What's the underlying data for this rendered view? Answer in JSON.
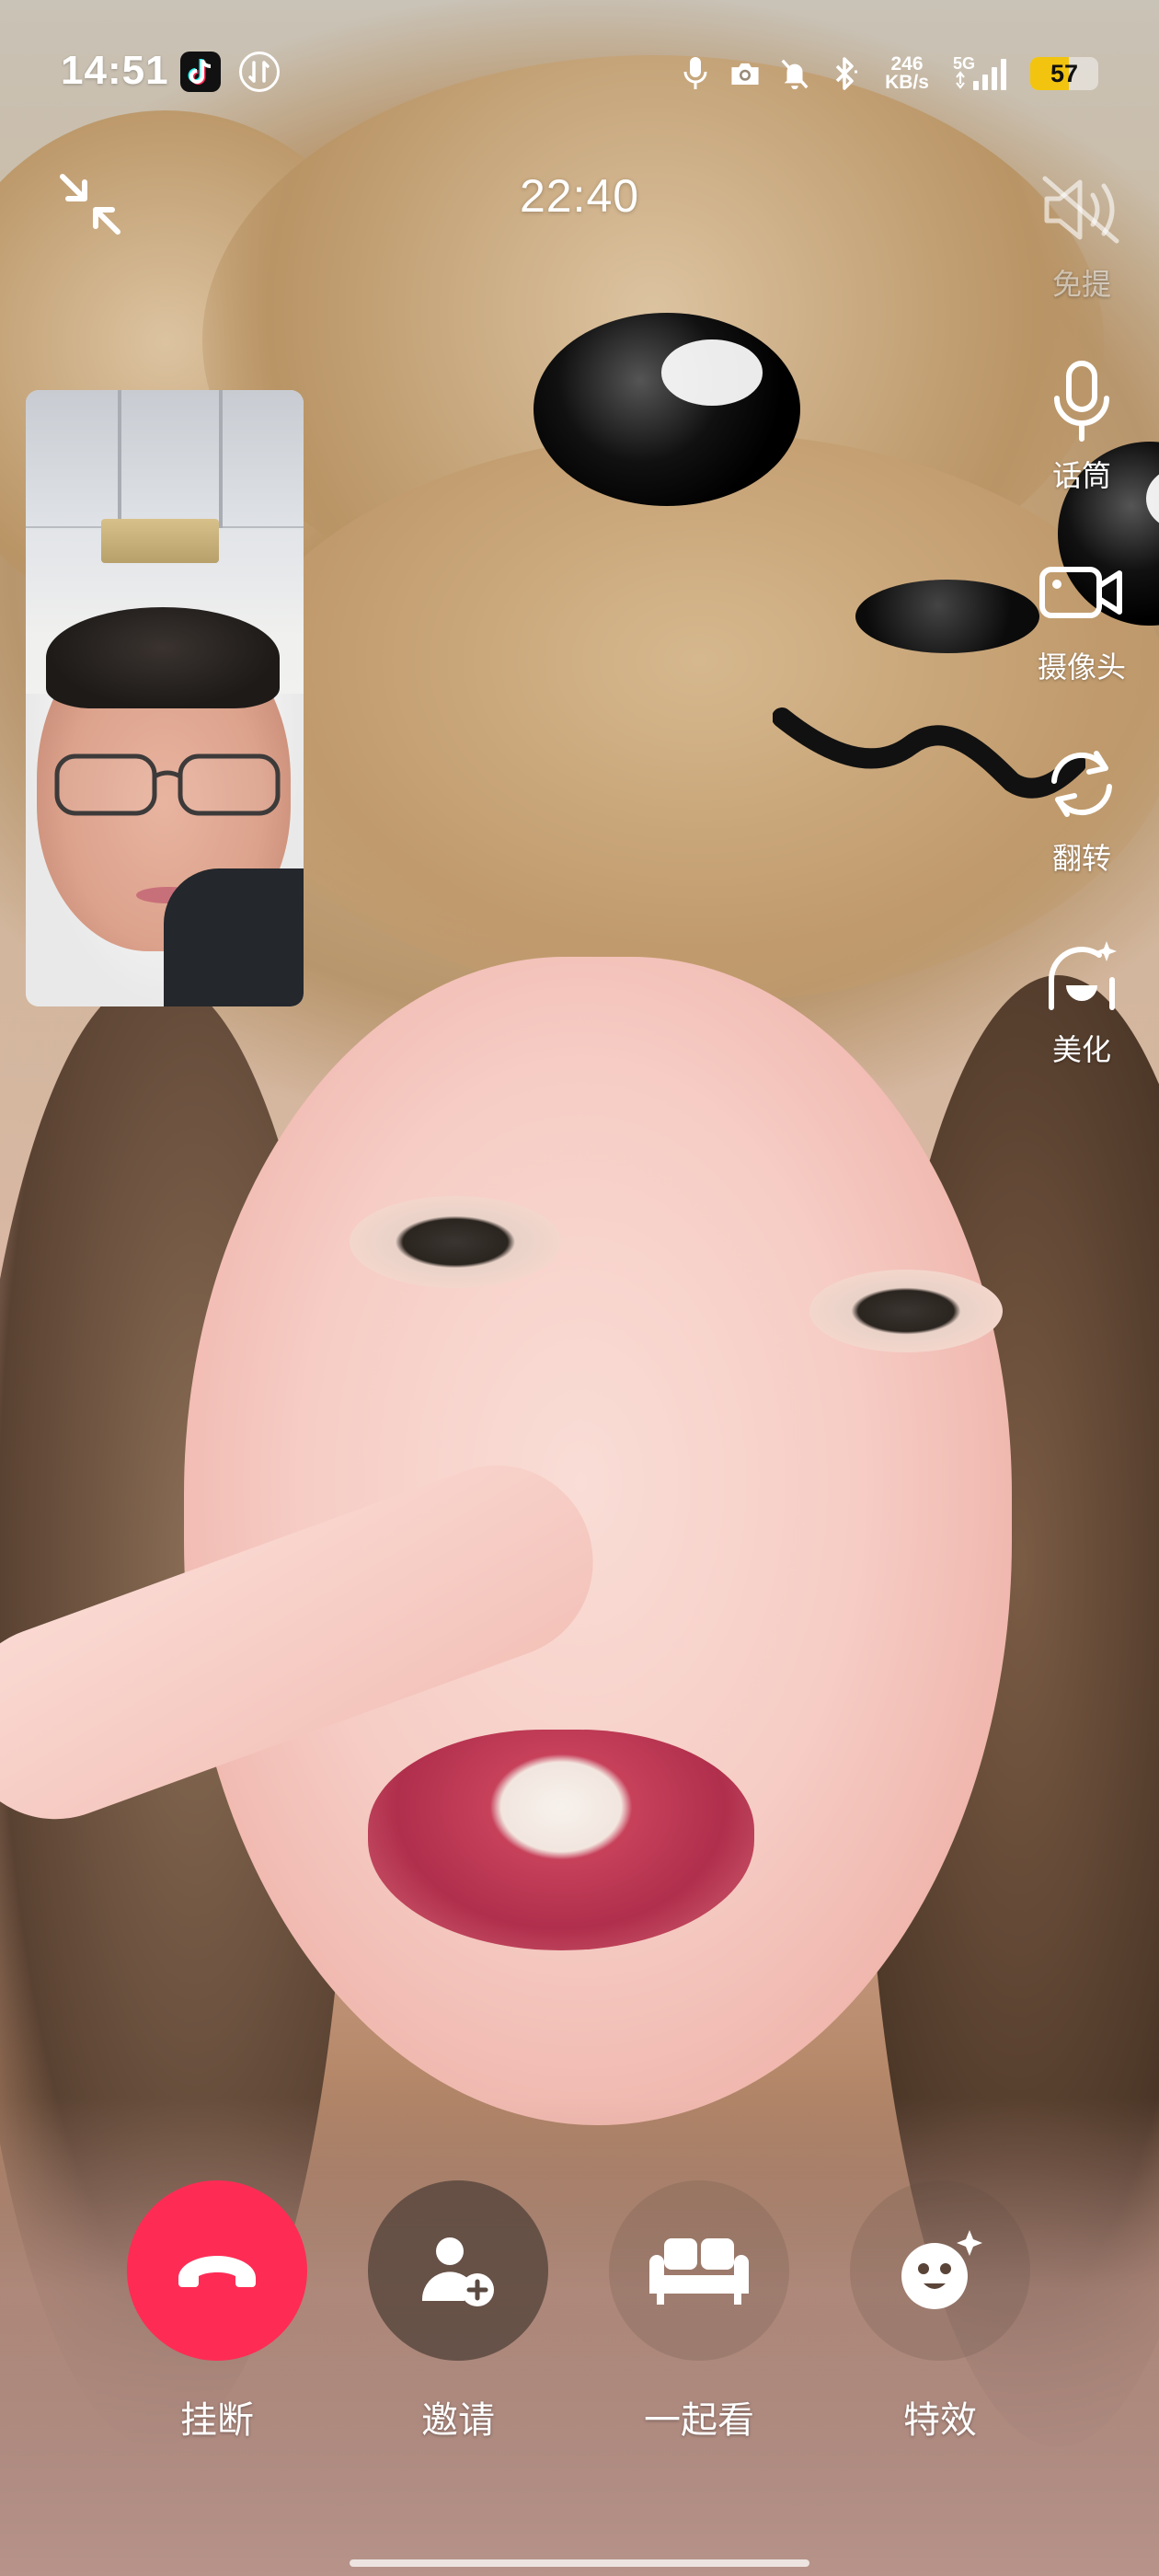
{
  "status_bar": {
    "time": "14:51",
    "net_speed_value": "246",
    "net_speed_unit": "KB/s",
    "network_type": "5G",
    "battery_level": "57",
    "battery_fraction": 0.57,
    "icons": [
      "tiktok-icon",
      "data-saver-icon",
      "microphone-icon",
      "camera-icon",
      "mute-icon",
      "bluetooth-icon",
      "signal-icon",
      "battery-icon"
    ]
  },
  "call": {
    "timer": "22:40"
  },
  "side_controls": [
    {
      "id": "speaker",
      "label": "免提",
      "icon": "speaker-off-icon",
      "enabled": false
    },
    {
      "id": "microphone",
      "label": "话筒",
      "icon": "microphone-icon",
      "enabled": true
    },
    {
      "id": "camera",
      "label": "摄像头",
      "icon": "video-camera-icon",
      "enabled": true
    },
    {
      "id": "flip",
      "label": "翻转",
      "icon": "flip-camera-icon",
      "enabled": true
    },
    {
      "id": "beautify",
      "label": "美化",
      "icon": "beautify-icon",
      "enabled": true
    }
  ],
  "bottom_controls": [
    {
      "id": "hangup",
      "label": "挂断",
      "icon": "hang-up-icon",
      "color": "#FE2C55"
    },
    {
      "id": "invite",
      "label": "邀请",
      "icon": "add-user-icon",
      "color": "#5A4A42"
    },
    {
      "id": "watch_together",
      "label": "一起看",
      "icon": "sofa-icon",
      "color": "transparent"
    },
    {
      "id": "effects",
      "label": "特效",
      "icon": "effects-icon",
      "color": "transparent"
    }
  ],
  "colors": {
    "hangup": "#FE2C55",
    "battery": "#F2C40F"
  }
}
